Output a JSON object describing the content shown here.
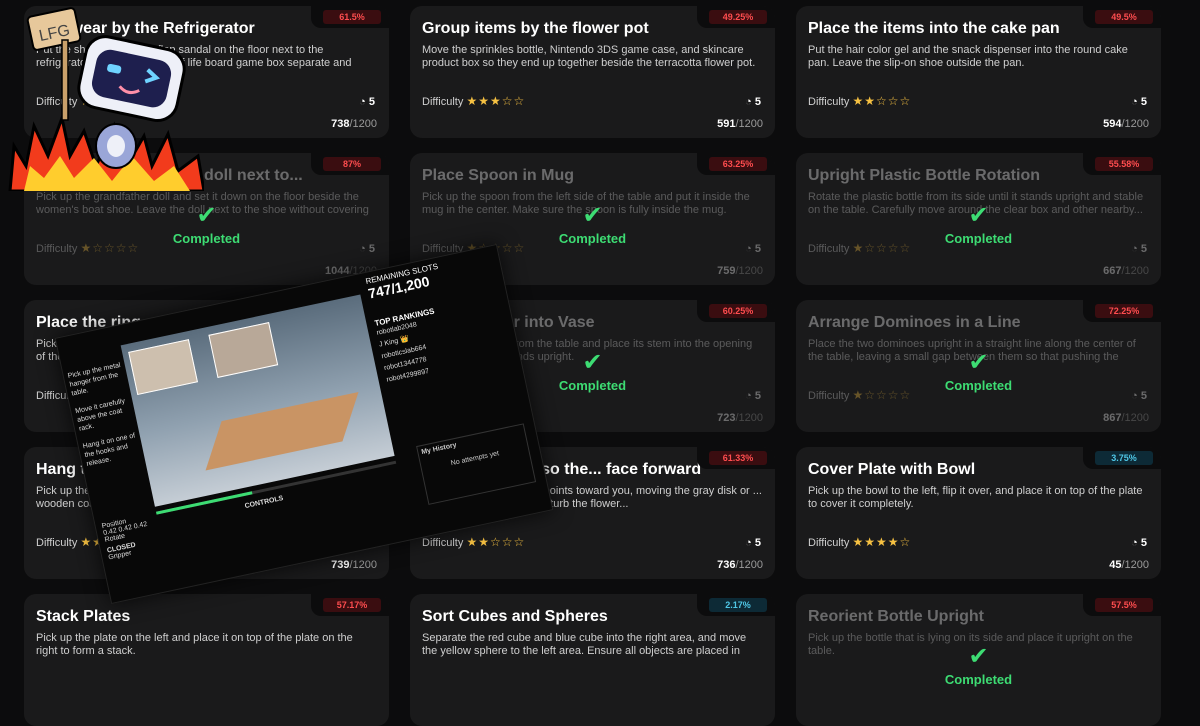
{
  "cards": [
    {
      "title": "Footwear by the Refrigerator",
      "desc": "Put the shoe and the flip flop sandal on the floor next to the refrigerator. Keep the Game of life board game box separate and away from the shoes.",
      "pct": "61.5%",
      "pct_color": "red",
      "difficulty_label": "Difficulty",
      "stars": "★☆☆☆☆",
      "timer": "5",
      "count": "738",
      "total": "/1200",
      "completed": false
    },
    {
      "title": "Group items by the flower pot",
      "desc": "Move the sprinkles bottle, Nintendo 3DS game case, and skincare product box so they end up together beside the terracotta flower pot.",
      "pct": "49.25%",
      "pct_color": "red",
      "difficulty_label": "Difficulty",
      "stars": "★★★☆☆",
      "timer": "5",
      "count": "591",
      "total": "/1200",
      "completed": false
    },
    {
      "title": "Place the items into the cake pan",
      "desc": "Put the hair color gel and the snack dispenser into the round cake pan. Leave the slip-on shoe outside the pan.",
      "pct": "49.5%",
      "pct_color": "red",
      "difficulty_label": "Difficulty",
      "stars": "★★☆☆☆",
      "timer": "5",
      "count": "594",
      "total": "/1200",
      "completed": false
    },
    {
      "title": "Place the grandfather doll next to...",
      "desc": "Pick up the grandfather doll and set it down on the floor beside the women's boat shoe. Leave the doll next to the shoe without covering it.",
      "pct": "87%",
      "pct_color": "red",
      "difficulty_label": "Difficulty",
      "stars": "★☆☆☆☆",
      "timer": "5",
      "count": "1044",
      "total": "/1200",
      "completed": true
    },
    {
      "title": "Place Spoon in Mug",
      "desc": "Pick up the spoon from the left side of the table and put it inside the mug in the center. Make sure the spoon is fully inside the mug.",
      "pct": "63.25%",
      "pct_color": "red",
      "difficulty_label": "Difficulty",
      "stars": "★☆☆☆☆",
      "timer": "5",
      "count": "759",
      "total": "/1200",
      "completed": true
    },
    {
      "title": "Upright Plastic Bottle Rotation",
      "desc": "Rotate the plastic bottle from its side until it stands upright and stable on the table. Carefully move around the clear box and other nearby...",
      "pct": "55.58%",
      "pct_color": "red",
      "difficulty_label": "Difficulty",
      "stars": "★☆☆☆☆",
      "timer": "5",
      "count": "667",
      "total": "/1200",
      "completed": true
    },
    {
      "title": "Place the ring on the headphone",
      "desc": "Pick up the metallic ring from the table and place it on the top surface of the wooden headphone stand.",
      "pct": "",
      "pct_color": "red",
      "difficulty_label": "Difficulty",
      "stars": "",
      "timer": "",
      "count": "",
      "total": "",
      "completed": false
    },
    {
      "title": "Place Flower into Vase",
      "desc": "Pick up the flower from the table and place its stem into the opening of the vase so it stands upright.",
      "pct": "60.25%",
      "pct_color": "red",
      "difficulty_label": "Difficulty",
      "stars": "★☆☆☆☆",
      "timer": "5",
      "count": "723",
      "total": "/1200",
      "completed": true
    },
    {
      "title": "Arrange Dominoes in a Line",
      "desc": "Place the two dominoes upright in a straight line along the center of the table, leaving a small gap between them so that pushing the front...",
      "pct": "72.25%",
      "pct_color": "red",
      "difficulty_label": "Difficulty",
      "stars": "★☆☆☆☆",
      "timer": "5",
      "count": "867",
      "total": "/1200",
      "completed": true
    },
    {
      "title": "Hang the hanger",
      "desc": "Pick up the metal hanger from the table and hang it on a hook of the wooden coat rack.",
      "pct": "",
      "pct_color": "red",
      "difficulty_label": "Difficulty",
      "stars": "★★☆☆☆",
      "timer": "5",
      "count": "739",
      "total": "/1200",
      "completed": false
    },
    {
      "title": "Rotate the disk so the... face forward",
      "desc": "Rotate the disk so the ... points toward you, moving the gray disk or ... away. Be careful not to disturb the flower...",
      "pct": "61.33%",
      "pct_color": "red",
      "difficulty_label": "Difficulty",
      "stars": "★★☆☆☆",
      "timer": "5",
      "count": "736",
      "total": "/1200",
      "completed": false
    },
    {
      "title": "Cover Plate with Bowl",
      "desc": "Pick up the bowl to the left, flip it over, and place it on top of the plate to cover it completely.",
      "pct": "3.75%",
      "pct_color": "blue",
      "difficulty_label": "Difficulty",
      "stars": "★★★★☆",
      "timer": "5",
      "count": "45",
      "total": "/1200",
      "completed": false
    },
    {
      "title": "Stack Plates",
      "desc": "Pick up the plate on the left and place it on top of the plate on the right to form a stack.",
      "pct": "57.17%",
      "pct_color": "red",
      "difficulty_label": "",
      "stars": "",
      "timer": "",
      "count": "",
      "total": "",
      "completed": false
    },
    {
      "title": "Sort Cubes and Spheres",
      "desc": "Separate the red cube and blue cube into the right area, and move the yellow sphere to the left area. Ensure all objects are placed in their...",
      "pct": "2.17%",
      "pct_color": "blue",
      "difficulty_label": "",
      "stars": "",
      "timer": "",
      "count": "",
      "total": "",
      "completed": false
    },
    {
      "title": "Reorient Bottle Upright",
      "desc": "Pick up the bottle that is lying on its side and place it upright on the table.",
      "pct": "57.5%",
      "pct_color": "red",
      "difficulty_label": "",
      "stars": "",
      "timer": "",
      "count": "",
      "total": "",
      "completed": true
    }
  ],
  "completed_label": "Completed",
  "overlay": {
    "remaining_label": "REMAINING SLOTS",
    "remaining_value": "747/1,200",
    "top_rankings": "TOP RANKINGS",
    "rankings": [
      "robotlab2048",
      "J King 👑",
      "roboticslab664",
      "robot1344778",
      "robot4299897"
    ],
    "instructions": [
      "Pick up the metal hanger from the table.",
      "Move it carefully above the coat rack.",
      "Hang it on one of the hooks and release."
    ],
    "controls_label": "CONTROLS",
    "history_label": "My History",
    "history_empty": "No attempts yet",
    "grip_label": "CLOSED",
    "grip_sub": "Gripper",
    "position_label": "Position",
    "rotate_label": "Rotate",
    "values": [
      "0.42",
      "0.42",
      "0.42"
    ]
  },
  "mascot": {
    "sign": "LFG"
  }
}
